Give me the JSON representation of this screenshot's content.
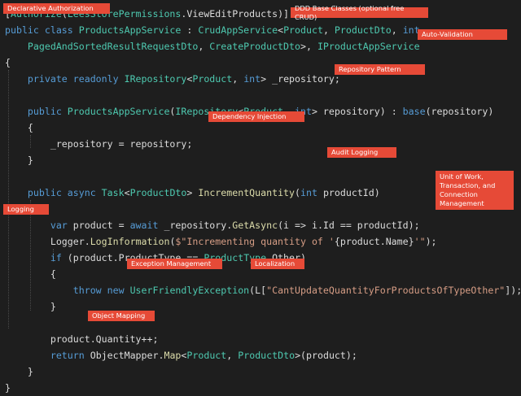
{
  "code_lines": [
    [
      {
        "t": "[",
        "c": "pn"
      },
      {
        "t": "Authorize",
        "c": "ty"
      },
      {
        "t": "(",
        "c": "pn"
      },
      {
        "t": "LeesStorePermissions",
        "c": "ty"
      },
      {
        "t": ".ViewEditProducts)]",
        "c": "pn"
      }
    ],
    [
      {
        "t": "public class ",
        "c": "kw"
      },
      {
        "t": "ProductsAppService",
        "c": "ty"
      },
      {
        "t": " : ",
        "c": "pn"
      },
      {
        "t": "CrudAppService",
        "c": "ty"
      },
      {
        "t": "<",
        "c": "pn"
      },
      {
        "t": "Product",
        "c": "ty"
      },
      {
        "t": ", ",
        "c": "pn"
      },
      {
        "t": "ProductDto",
        "c": "ty"
      },
      {
        "t": ", ",
        "c": "pn"
      },
      {
        "t": "int",
        "c": "kw"
      },
      {
        "t": ",",
        "c": "pn"
      }
    ],
    [
      {
        "t": "    ",
        "c": "pn"
      },
      {
        "t": "PagedAndSortedResultRequestDto",
        "c": "ty"
      },
      {
        "t": ", ",
        "c": "pn"
      },
      {
        "t": "CreateProductDto",
        "c": "ty"
      },
      {
        "t": ">, ",
        "c": "pn"
      },
      {
        "t": "IProductAppService",
        "c": "ty"
      }
    ],
    [
      {
        "t": "{",
        "c": "pn"
      }
    ],
    [
      {
        "t": "    private readonly ",
        "c": "kw"
      },
      {
        "t": "IRepository",
        "c": "ty"
      },
      {
        "t": "<",
        "c": "pn"
      },
      {
        "t": "Product",
        "c": "ty"
      },
      {
        "t": ", ",
        "c": "pn"
      },
      {
        "t": "int",
        "c": "kw"
      },
      {
        "t": "> _repository;",
        "c": "pn"
      }
    ],
    [],
    [
      {
        "t": "    public ",
        "c": "kw"
      },
      {
        "t": "ProductsAppService",
        "c": "ty"
      },
      {
        "t": "(",
        "c": "pn"
      },
      {
        "t": "IRepository",
        "c": "ty"
      },
      {
        "t": "<",
        "c": "pn"
      },
      {
        "t": "Product",
        "c": "ty"
      },
      {
        "t": ", ",
        "c": "pn"
      },
      {
        "t": "int",
        "c": "kw"
      },
      {
        "t": "> repository) : ",
        "c": "pn"
      },
      {
        "t": "base",
        "c": "kw"
      },
      {
        "t": "(repository)",
        "c": "pn"
      }
    ],
    [
      {
        "t": "    {",
        "c": "pn"
      }
    ],
    [
      {
        "t": "        _repository = repository;",
        "c": "pn"
      }
    ],
    [
      {
        "t": "    }",
        "c": "pn"
      }
    ],
    [],
    [
      {
        "t": "    public async ",
        "c": "kw"
      },
      {
        "t": "Task",
        "c": "ty"
      },
      {
        "t": "<",
        "c": "pn"
      },
      {
        "t": "ProductDto",
        "c": "ty"
      },
      {
        "t": "> ",
        "c": "pn"
      },
      {
        "t": "IncrementQuantity",
        "c": "mt"
      },
      {
        "t": "(",
        "c": "pn"
      },
      {
        "t": "int",
        "c": "kw"
      },
      {
        "t": " productId)",
        "c": "pn"
      }
    ],
    [
      {
        "t": "    {",
        "c": "pn"
      }
    ],
    [
      {
        "t": "        ",
        "c": "pn"
      },
      {
        "t": "var",
        "c": "kw"
      },
      {
        "t": " product = ",
        "c": "pn"
      },
      {
        "t": "await",
        "c": "kw"
      },
      {
        "t": " _repository.",
        "c": "pn"
      },
      {
        "t": "GetAsync",
        "c": "mt"
      },
      {
        "t": "(i => i.Id == productId);",
        "c": "pn"
      }
    ],
    [
      {
        "t": "        Logger.",
        "c": "pn"
      },
      {
        "t": "LogInformation",
        "c": "mt"
      },
      {
        "t": "(",
        "c": "pn"
      },
      {
        "t": "$\"Incrementing quantity of '",
        "c": "st"
      },
      {
        "t": "{product.Name}",
        "c": "pn"
      },
      {
        "t": "'\"",
        "c": "st"
      },
      {
        "t": ");",
        "c": "pn"
      }
    ],
    [
      {
        "t": "        ",
        "c": "pn"
      },
      {
        "t": "if",
        "c": "kw"
      },
      {
        "t": " (product.ProductType == ",
        "c": "pn"
      },
      {
        "t": "ProductType",
        "c": "ty"
      },
      {
        "t": ".Other)",
        "c": "pn"
      }
    ],
    [
      {
        "t": "        {",
        "c": "pn"
      }
    ],
    [
      {
        "t": "            ",
        "c": "pn"
      },
      {
        "t": "throw new ",
        "c": "kw"
      },
      {
        "t": "UserFriendlyException",
        "c": "ty"
      },
      {
        "t": "(L[",
        "c": "pn"
      },
      {
        "t": "\"CantUpdateQuantityForProductsOfTypeOther\"",
        "c": "st"
      },
      {
        "t": "]);",
        "c": "pn"
      }
    ],
    [
      {
        "t": "        }",
        "c": "pn"
      }
    ],
    [],
    [
      {
        "t": "        product.Quantity++;",
        "c": "pn"
      }
    ],
    [
      {
        "t": "        ",
        "c": "pn"
      },
      {
        "t": "return",
        "c": "kw"
      },
      {
        "t": " ObjectMapper.",
        "c": "pn"
      },
      {
        "t": "Map",
        "c": "mt"
      },
      {
        "t": "<",
        "c": "pn"
      },
      {
        "t": "Product",
        "c": "ty"
      },
      {
        "t": ", ",
        "c": "pn"
      },
      {
        "t": "ProductDto",
        "c": "ty"
      },
      {
        "t": ">(product);",
        "c": "pn"
      }
    ],
    [
      {
        "t": "    }",
        "c": "pn"
      }
    ],
    [
      {
        "t": "}",
        "c": "pn"
      }
    ]
  ],
  "annotations": [
    {
      "name": "annotation-declarative-authorization",
      "text": "Declarative Authorization"
    },
    {
      "name": "annotation-ddd-base-classes",
      "text": "DDD Base Classes (optional free CRUD)"
    },
    {
      "name": "annotation-auto-validation",
      "text": "Auto-Validation"
    },
    {
      "name": "annotation-repository-pattern",
      "text": "Repository Pattern"
    },
    {
      "name": "annotation-dependency-injection",
      "text": "Dependency Injection"
    },
    {
      "name": "annotation-audit-logging",
      "text": "Audit Logging"
    },
    {
      "name": "annotation-unit-of-work",
      "text": "Unit of Work,\nTransaction, and\nConnection\nManagement"
    },
    {
      "name": "annotation-logging",
      "text": "Logging"
    },
    {
      "name": "annotation-exception-management",
      "text": "Exception Management"
    },
    {
      "name": "annotation-localization",
      "text": "Localization"
    },
    {
      "name": "annotation-object-mapping",
      "text": "Object Mapping"
    }
  ],
  "colors": {
    "background": "#1e1e1e",
    "keyword": "#569cd6",
    "type": "#4ec9b0",
    "method": "#dcdcaa",
    "string": "#d69d85",
    "plain": "#dcdcdc",
    "annotation_bg": "#e64a37"
  }
}
